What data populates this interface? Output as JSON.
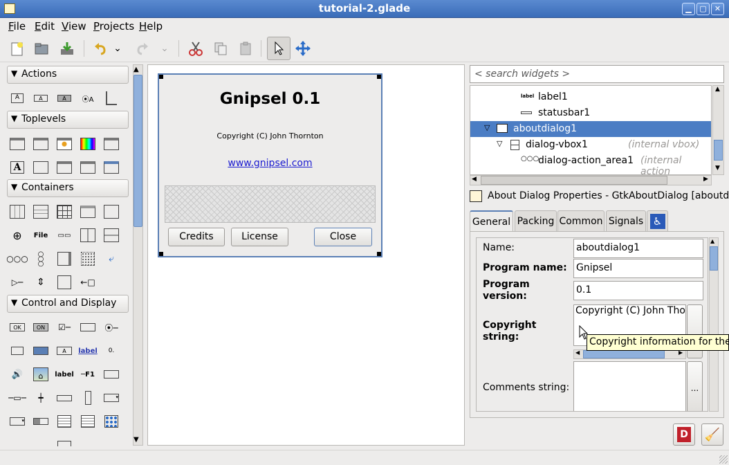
{
  "window": {
    "title": "tutorial-2.glade"
  },
  "menubar": {
    "items": [
      {
        "label": "File",
        "u": "F",
        "rest": "ile"
      },
      {
        "label": "Edit",
        "u": "E",
        "rest": "dit"
      },
      {
        "label": "View",
        "u": "V",
        "rest": "iew"
      },
      {
        "label": "Projects",
        "u": "P",
        "rest": "rojects"
      },
      {
        "label": "Help",
        "u": "H",
        "rest": "elp"
      }
    ]
  },
  "palette": {
    "groups": [
      "Actions",
      "Toplevels",
      "Containers",
      "Control and Display"
    ],
    "label_icon_text": "label",
    "bold_label_icon": "label",
    "file_icon": "File",
    "f1_icon": "F1",
    "ok_icon": "OK",
    "on_icon": "ON"
  },
  "dialog": {
    "title": "Gnipsel 0.1",
    "copyright": "Copyright (C) John Thornton",
    "link": "www.gnipsel.com",
    "buttons": {
      "credits": "Credits",
      "license": "License",
      "close": "Close"
    }
  },
  "search": {
    "placeholder": "< search widgets >"
  },
  "tree": {
    "rows": [
      {
        "label": "label1",
        "aux": "",
        "icon": "label"
      },
      {
        "label": "statusbar1",
        "aux": ""
      },
      {
        "label": "aboutdialog1",
        "aux": ""
      },
      {
        "label": "dialog-vbox1",
        "aux": "(internal vbox)"
      },
      {
        "label": "dialog-action_area1",
        "aux": "(internal action"
      }
    ]
  },
  "properties": {
    "header": "About Dialog Properties - GtkAboutDialog [aboutdi...",
    "tabs": [
      "General",
      "Packing",
      "Common",
      "Signals"
    ],
    "fields": {
      "name_label": "Name:",
      "name_value": "aboutdialog1",
      "program_name_label": "Program name:",
      "program_name_value": "Gnipsel",
      "program_version_label_1": "Program",
      "program_version_label_2": "version:",
      "program_version_value": "0.1",
      "copyright_label_1": "Copyright",
      "copyright_label_2": "string:",
      "copyright_value": "Copyright (C) John Thornt",
      "comments_label": "Comments string:",
      "ellipsis": "..."
    },
    "tooltip": "Copyright information for the p"
  },
  "colors": {
    "selection": "#4b7dc4",
    "titlebar": "#3a6cb8"
  }
}
